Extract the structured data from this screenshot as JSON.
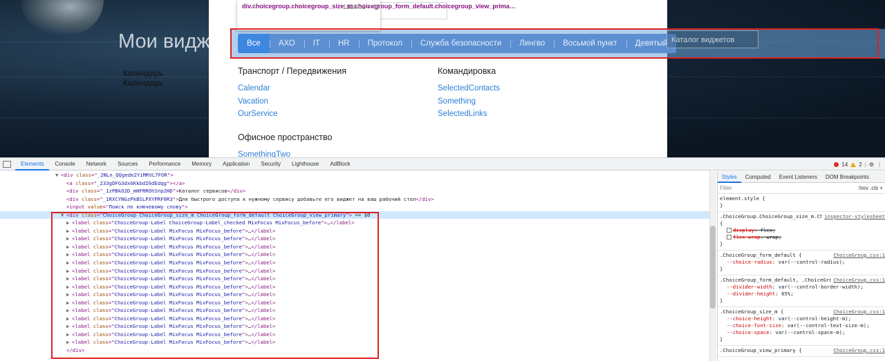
{
  "page": {
    "heading": "Мои видж",
    "side_widgets": [
      "Календарь",
      "Календарь"
    ],
    "catalog_button": "Каталог виджетов"
  },
  "tooltip": {
    "selector": "div.choicegroup.choicegroup_size_m.choicegroup_form_default.choicegroup_view_prima…",
    "dimensions": "1826.02 × 42"
  },
  "choices": [
    {
      "label": "Все",
      "checked": true
    },
    {
      "label": "АХО"
    },
    {
      "label": "IT"
    },
    {
      "label": "HR"
    },
    {
      "label": "Протокол"
    },
    {
      "label": "Служба безопасности"
    },
    {
      "label": "Лингво"
    },
    {
      "label": "Восьмой пункт"
    },
    {
      "label": "Девятый"
    }
  ],
  "sections": [
    {
      "title": "Транспорт / Передвижения",
      "links": [
        "Calendar",
        "Vacation",
        "OurService"
      ]
    },
    {
      "title": "Командировка",
      "links": [
        "SelectedContacts",
        "Something",
        "SelectedLinks"
      ]
    },
    {
      "title": "Офисное пространство",
      "links": [
        "SomethingTwo"
      ]
    }
  ],
  "devtools": {
    "tabs": [
      "Elements",
      "Console",
      "Network",
      "Sources",
      "Performance",
      "Memory",
      "Application",
      "Security",
      "Lighthouse",
      "AdBlock"
    ],
    "active_tab": "Elements",
    "errors": "14",
    "warnings": "2",
    "code_lines": [
      {
        "indent": 1,
        "tri": "▼",
        "tag": "div",
        "attr": "class",
        "val": "_2NLn_QQgede2YiMRVL7FOR",
        "text": "",
        "close": false
      },
      {
        "indent": 2,
        "tri": "",
        "tag": "a",
        "attr": "class",
        "val": "_233gDFG3dx6KkbdI6dEdqg",
        "text": "",
        "close": true
      },
      {
        "indent": 2,
        "tri": "",
        "tag": "div",
        "attr": "class",
        "val": "_1zPBkO2D_mHFRROhSnp2HD",
        "text": "Каталог сервисов",
        "close": true
      },
      {
        "indent": 2,
        "tri": "",
        "tag": "div",
        "attr": "class",
        "val": "_1RXCYNGzPkBSLPXYPRF0R3",
        "text": "Для быстрого доступа к нужному сервису добавьте его виджет на ваш рабочий стол",
        "close": true
      },
      {
        "indent": 2,
        "tri": "",
        "tag": "input",
        "attr": "value",
        "val": "Поиск по ключевому слову",
        "text": "",
        "close": false
      },
      {
        "indent": 2,
        "tri": "▼",
        "tag": "div",
        "attr": "class",
        "val": "ChoiceGroup ChoiceGroup_size_m ChoiceGroup_form_default ChoiceGroup_view_primary",
        "text": "== $0",
        "close": false,
        "selected": true
      },
      {
        "indent": 3,
        "tri": "▶",
        "tag": "label",
        "attr": "class",
        "val": "ChoiceGroup-Label ChoiceGroup-Label_checked MixFocus MixFocus_before",
        "text": "…",
        "close": true
      },
      {
        "indent": 3,
        "tri": "▶",
        "tag": "label",
        "attr": "class",
        "val": "ChoiceGroup-Label MixFocus MixFocus_before",
        "text": "…",
        "close": true
      },
      {
        "indent": 3,
        "tri": "▶",
        "tag": "label",
        "attr": "class",
        "val": "ChoiceGroup-Label MixFocus MixFocus_before",
        "text": "…",
        "close": true
      },
      {
        "indent": 3,
        "tri": "▶",
        "tag": "label",
        "attr": "class",
        "val": "ChoiceGroup-Label MixFocus MixFocus_before",
        "text": "…",
        "close": true
      },
      {
        "indent": 3,
        "tri": "▶",
        "tag": "label",
        "attr": "class",
        "val": "ChoiceGroup-Label MixFocus MixFocus_before",
        "text": "…",
        "close": true
      },
      {
        "indent": 3,
        "tri": "▶",
        "tag": "label",
        "attr": "class",
        "val": "ChoiceGroup-Label MixFocus MixFocus_before",
        "text": "…",
        "close": true
      },
      {
        "indent": 3,
        "tri": "▶",
        "tag": "label",
        "attr": "class",
        "val": "ChoiceGroup-Label MixFocus MixFocus_before",
        "text": "…",
        "close": true
      },
      {
        "indent": 3,
        "tri": "▶",
        "tag": "label",
        "attr": "class",
        "val": "ChoiceGroup-Label MixFocus MixFocus_before",
        "text": "…",
        "close": true
      },
      {
        "indent": 3,
        "tri": "▶",
        "tag": "label",
        "attr": "class",
        "val": "ChoiceGroup-Label MixFocus MixFocus_before",
        "text": "…",
        "close": true
      },
      {
        "indent": 3,
        "tri": "▶",
        "tag": "label",
        "attr": "class",
        "val": "ChoiceGroup-Label MixFocus MixFocus_before",
        "text": "…",
        "close": true
      },
      {
        "indent": 3,
        "tri": "▶",
        "tag": "label",
        "attr": "class",
        "val": "ChoiceGroup-Label MixFocus MixFocus_before",
        "text": "…",
        "close": true
      },
      {
        "indent": 3,
        "tri": "▶",
        "tag": "label",
        "attr": "class",
        "val": "ChoiceGroup-Label MixFocus MixFocus_before",
        "text": "…",
        "close": true
      },
      {
        "indent": 3,
        "tri": "▶",
        "tag": "label",
        "attr": "class",
        "val": "ChoiceGroup-Label MixFocus MixFocus_before",
        "text": "…",
        "close": true
      },
      {
        "indent": 3,
        "tri": "▶",
        "tag": "label",
        "attr": "class",
        "val": "ChoiceGroup-Label MixFocus MixFocus_before",
        "text": "…",
        "close": true
      },
      {
        "indent": 3,
        "tri": "▶",
        "tag": "label",
        "attr": "class",
        "val": "ChoiceGroup-Label MixFocus MixFocus_before",
        "text": "…",
        "close": true
      },
      {
        "indent": 3,
        "tri": "▶",
        "tag": "label",
        "attr": "class",
        "val": "ChoiceGroup-Label MixFocus MixFocus_before",
        "text": "…",
        "close": true
      },
      {
        "indent": 2,
        "tri": "",
        "tag": "/div",
        "attr": "",
        "val": "",
        "text": "",
        "close": false
      }
    ],
    "styles_tabs": [
      "Styles",
      "Computed",
      "Event Listeners",
      "DOM Breakpoints"
    ],
    "filter_placeholder": "Filter",
    "filter_tools": ":hov .cls +",
    "rules": [
      {
        "selector": "element.style {",
        "source": "",
        "props": [],
        "end": "}"
      },
      {
        "selector": ".ChoiceGroup.ChoiceGroup_size_m.ChoiceGroup_form_default.ChoiceGroup_view_primary {",
        "source": "inspector-stylesheet",
        "props": [
          {
            "name": "display",
            "value": "flex;",
            "struck": true,
            "checkbox": true
          },
          {
            "name": "flex-wrap",
            "value": "wrap;",
            "struck": true,
            "checkbox": true
          }
        ],
        "end": "}"
      },
      {
        "selector": ".ChoiceGroup_form_default {",
        "source": "ChoiceGroup.css:1",
        "props": [
          {
            "name": "--choice-radius",
            "value": "var(--control-radius);"
          }
        ],
        "end": "}"
      },
      {
        "selector": ".ChoiceGroup_form_default, .ChoiceGroup_form_brick {",
        "source": "ChoiceGroup.css:1",
        "props": [
          {
            "name": "--divider-width",
            "value": "var(--control-border-width);"
          },
          {
            "name": "--divider-height",
            "value": "65%;"
          }
        ],
        "end": "}"
      },
      {
        "selector": ".ChoiceGroup_size_m {",
        "source": "ChoiceGroup.css:1",
        "props": [
          {
            "name": "--choice-height",
            "value": "var(--control-height-m);"
          },
          {
            "name": "--choice-font-size",
            "value": "var(--control-text-size-m);"
          },
          {
            "name": "--choice-space",
            "value": "var(--control-space-m);"
          }
        ],
        "end": "}"
      },
      {
        "selector": ".ChoiceGroup_view_primary {",
        "source": "ChoiceGroup.css:1",
        "props": [],
        "end": ""
      }
    ]
  },
  "colors": {
    "choice_bg": "#5b8fd1",
    "choice_checked": "#3d87e0",
    "link": "#2c7fd6",
    "highlight": "#e02020"
  }
}
